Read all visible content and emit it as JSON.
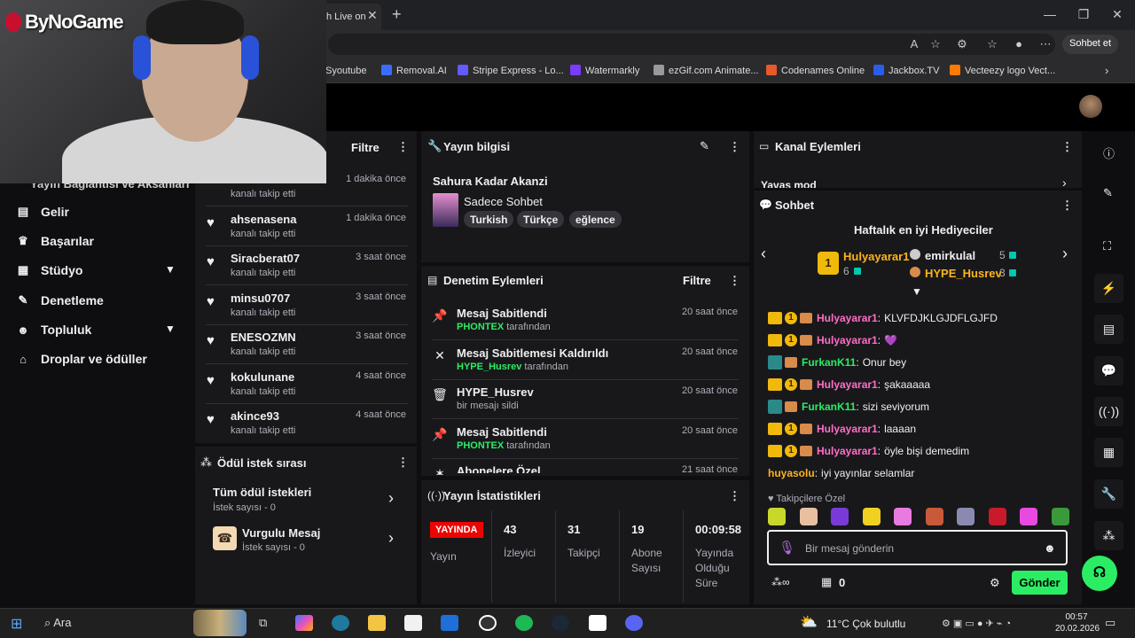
{
  "browser": {
    "tab_title": "h Live on",
    "sohbet_label": "Sohbet et",
    "bookmarks": [
      {
        "label": "Syoutube",
        "color": "#cc0000"
      },
      {
        "label": "Removal.AI",
        "color": "#3b6cff"
      },
      {
        "label": "Stripe Express - Lo...",
        "color": "#635bff"
      },
      {
        "label": "Watermarkly",
        "color": "#7b3cff"
      },
      {
        "label": "ezGif.com Animate...",
        "color": "#999999"
      },
      {
        "label": "Codenames Online",
        "color": "#e85a2a"
      },
      {
        "label": "Jackbox.TV",
        "color": "#2a5de8"
      },
      {
        "label": "Vecteezy logo Vect...",
        "color": "#ff7a00"
      }
    ]
  },
  "webcam": {
    "logo": "ByNoGame"
  },
  "nav": {
    "cut_item": "Yayın Bağlantısı ve Aksanları",
    "items": [
      {
        "label": "Gelir",
        "icon": "▤"
      },
      {
        "label": "Başarılar",
        "icon": "♛"
      },
      {
        "label": "Stüdyo",
        "icon": "▦"
      },
      {
        "label": "Denetleme",
        "icon": "✎"
      },
      {
        "label": "Topluluk",
        "icon": "☻"
      },
      {
        "label": "Droplar ve ödüller",
        "icon": "⌂"
      }
    ]
  },
  "feed": {
    "filter": "Filtre",
    "first_sub": "kanalı takip etti",
    "first_time": "1 dakika önce",
    "items": [
      {
        "name": "ahsenasena",
        "sub": "kanalı takip etti",
        "time": "1 dakika önce"
      },
      {
        "name": "Siracberat07",
        "sub": "kanalı takip etti",
        "time": "3 saat önce"
      },
      {
        "name": "minsu0707",
        "sub": "kanalı takip etti",
        "time": "3 saat önce"
      },
      {
        "name": "ENESOZMN",
        "sub": "kanalı takip etti",
        "time": "3 saat önce"
      },
      {
        "name": "kokulunane",
        "sub": "kanalı takip etti",
        "time": "4 saat önce"
      },
      {
        "name": "akince93",
        "sub": "kanalı takip etti",
        "time": "4 saat önce"
      }
    ]
  },
  "reward": {
    "title": "Ödül istek sırası",
    "items": [
      {
        "title": "Tüm ödül istekleri",
        "sub": "İstek sayısı - 0"
      },
      {
        "title": "Vurgulu Mesaj",
        "sub": "İstek sayısı - 0"
      }
    ]
  },
  "info": {
    "title": "Yayın bilgisi",
    "stream_title": "Sahura Kadar Akanzi",
    "category": "Sadece Sohbet",
    "tags": [
      "Turkish",
      "Türkçe",
      "eğlence"
    ]
  },
  "mod": {
    "title": "Denetim Eylemleri",
    "filter": "Filtre",
    "items": [
      {
        "title": "Mesaj Sabitlendi",
        "user": "PHONTEX",
        "rest": " tarafından",
        "time": "20 saat önce",
        "icon": "📌"
      },
      {
        "title": "Mesaj Sabitlemesi Kaldırıldı",
        "user": "HYPE_Husrev",
        "rest": " tarafından",
        "time": "20 saat önce",
        "icon": "✕"
      },
      {
        "title": "HYPE_Husrev",
        "user": "",
        "rest": "bir mesajı sildi",
        "time": "20 saat önce",
        "icon": "🗑"
      },
      {
        "title": "Mesaj Sabitlendi",
        "user": "PHONTEX",
        "rest": " tarafından",
        "time": "20 saat önce",
        "icon": "📌"
      },
      {
        "title": "Abonelere Özel",
        "user": "",
        "rest": "",
        "time": "21 saat önce",
        "icon": "✶"
      }
    ]
  },
  "stats": {
    "title": "Yayın İstatistikleri",
    "live": "YAYINDA",
    "live_label": "Yayın",
    "items": [
      {
        "value": "43",
        "label": "İzleyici"
      },
      {
        "value": "31",
        "label": "Takipçi"
      },
      {
        "value": "19",
        "label": "Abone Sayısı"
      },
      {
        "value": "00:09:58",
        "label": "Yayında Olduğu Süre"
      }
    ]
  },
  "chan": {
    "title": "Kanal Eylemleri",
    "mode": "Yavaş mod"
  },
  "chat": {
    "title": "Sohbet",
    "gifters_title": "Haftalık en iyi Hediyeciler",
    "top_gifter": {
      "name": "Hulyayarar1",
      "count": "6",
      "rank": "1"
    },
    "gifters": [
      {
        "name": "emirkulal",
        "count": "5"
      },
      {
        "name": "HYPE_Husrev",
        "count": "3"
      }
    ],
    "messages": [
      {
        "user": "Hulyayarar1",
        "text": "KLVFDJKLGJDFLGJFD",
        "badges": "vip"
      },
      {
        "user": "Hulyayarar1",
        "text": "💜",
        "badges": "vip"
      },
      {
        "user": "FurkanK11",
        "text": "Onur bey",
        "badges": "gg"
      },
      {
        "user": "Hulyayarar1",
        "text": "şakaaaaa",
        "badges": "vip"
      },
      {
        "user": "FurkanK11",
        "text": "sizi seviyorum",
        "badges": "gg"
      },
      {
        "user": "Hulyayarar1",
        "text": "laaaan",
        "badges": "vip"
      },
      {
        "user": "Hulyayarar1",
        "text": "öyle bişi demedim",
        "badges": "vip"
      },
      {
        "user": "huyasolu",
        "text": "iyi yayınlar selamlar",
        "badges": "none"
      }
    ],
    "emote_header": "Takipçilere Özel",
    "placeholder": "Bir mesaj gönderin",
    "points": "0",
    "send": "Gönder"
  },
  "taskbar": {
    "search": "Ara",
    "weather": "11°C  Çok bulutlu",
    "time": "00:57",
    "date": "20.02.2026"
  }
}
